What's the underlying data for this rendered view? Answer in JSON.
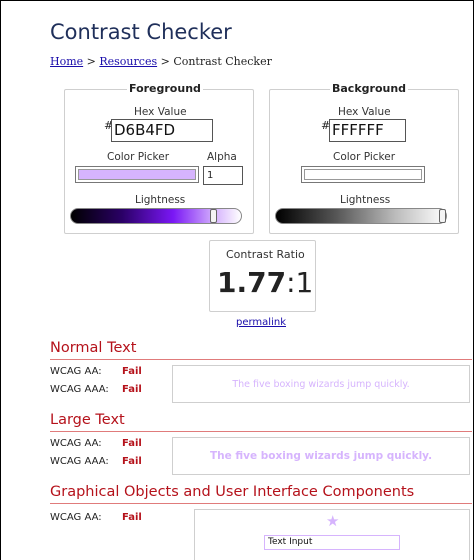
{
  "page": {
    "title": "Contrast Checker"
  },
  "breadcrumb": {
    "home": "Home",
    "sep1": ">",
    "resources": "Resources",
    "sep2": ">",
    "current": "Contrast Checker"
  },
  "foreground": {
    "legend": "Foreground",
    "hex_label": "Hex Value",
    "hash": "#",
    "hex_value": "D6B4FD",
    "picker_label": "Color Picker",
    "alpha_label": "Alpha",
    "alpha_value": "1",
    "lightness_label": "Lightness",
    "color": "#D6B4FD",
    "lightness_level": 0.85
  },
  "background": {
    "legend": "Background",
    "hex_label": "Hex Value",
    "hash": "#",
    "hex_value": "FFFFFF",
    "picker_label": "Color Picker",
    "lightness_label": "Lightness",
    "color": "#FFFFFF",
    "lightness_level": 1.0
  },
  "contrast": {
    "label": "Contrast Ratio",
    "value": "1.77",
    "suffix": ":1",
    "permalink": "permalink"
  },
  "normal_text": {
    "heading": "Normal Text",
    "aa_label": "WCAG AA:",
    "aa_result": "Fail",
    "aaa_label": "WCAG AAA:",
    "aaa_result": "Fail",
    "sample": "The five boxing wizards jump quickly."
  },
  "large_text": {
    "heading": "Large Text",
    "aa_label": "WCAG AA:",
    "aa_result": "Fail",
    "aaa_label": "WCAG AAA:",
    "aaa_result": "Fail",
    "sample": "The five boxing wizards jump quickly."
  },
  "graphical": {
    "heading": "Graphical Objects and User Interface Components",
    "aa_label": "WCAG AA:",
    "aa_result": "Fail",
    "input_value": "Text Input",
    "icon": "star-icon"
  },
  "colors": {
    "fail": "#b5121b",
    "title": "#1f2f5a",
    "link": "#1a0dab",
    "sample_text": "#D6B4FD"
  }
}
